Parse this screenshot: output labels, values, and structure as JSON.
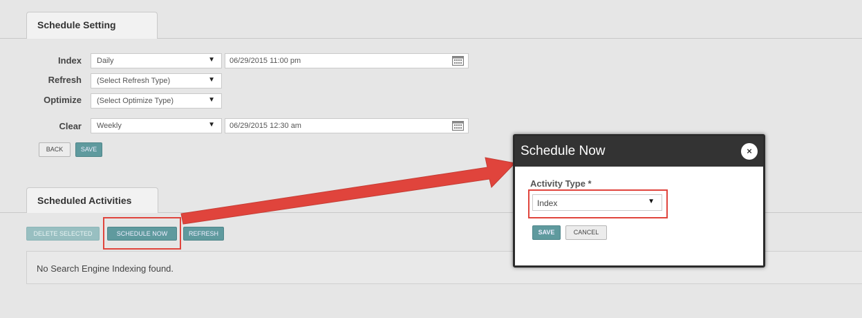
{
  "schedule_setting": {
    "tab_label": "Schedule Setting",
    "rows": [
      {
        "label": "Index",
        "select_value": "Daily",
        "date_value": "06/29/2015 11:00 pm"
      },
      {
        "label": "Refresh",
        "select_value": "(Select Refresh Type)"
      },
      {
        "label": "Optimize",
        "select_value": "(Select Optimize Type)"
      },
      {
        "label": "Clear",
        "select_value": "Weekly",
        "date_value": "06/29/2015 12:30 am"
      }
    ],
    "back_label": "BACK",
    "save_label": "SAVE"
  },
  "scheduled_activities": {
    "tab_label": "Scheduled Activities",
    "delete_selected_label": "DELETE SELECTED",
    "schedule_now_label": "SCHEDULE NOW",
    "refresh_label": "REFRESH",
    "empty_message": "No Search Engine Indexing found."
  },
  "modal": {
    "title": "Schedule Now",
    "close_glyph": "×",
    "field_label": "Activity Type *",
    "select_value": "Index",
    "save_label": "SAVE",
    "cancel_label": "CANCEL"
  },
  "icons": {
    "dropdown_arrow": "▼",
    "calendar": "calendar-icon"
  },
  "colors": {
    "accent_teal": "#5f9a9e",
    "annotation_red": "#e0443c",
    "modal_header": "#333333"
  }
}
